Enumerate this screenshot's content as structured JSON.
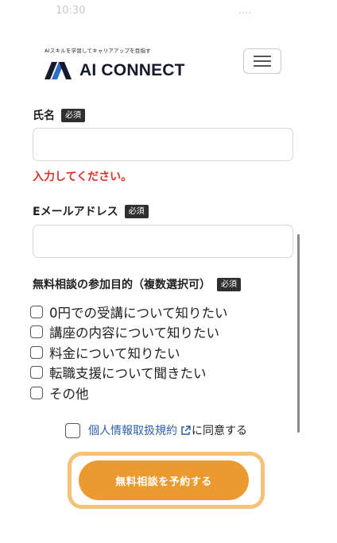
{
  "status_bar": {
    "left_text": "10:30",
    "right_text": "...."
  },
  "header": {
    "tagline": "AIスキルを学習してキャリアアップを目指す",
    "brand": "AI CONNECT",
    "brand_color": "#15192b"
  },
  "form": {
    "name": {
      "label": "氏名",
      "badge": "必須",
      "value": "",
      "error": "入力してください。"
    },
    "email": {
      "label": "Eメールアドレス",
      "badge": "必須",
      "value": ""
    },
    "purpose": {
      "label": "無料相談の参加目的（複数選択可）",
      "badge": "必須",
      "options": [
        {
          "label": "0円での受講について知りたい",
          "checked": false
        },
        {
          "label": "講座の内容について知りたい",
          "checked": false
        },
        {
          "label": "料金について知りたい",
          "checked": false
        },
        {
          "label": "転職支援について聞きたい",
          "checked": false
        },
        {
          "label": "その他",
          "checked": false
        }
      ]
    },
    "agreement": {
      "link_text": "個人情報取扱規約",
      "suffix": "に同意する",
      "checked": false
    },
    "submit_label": "無料相談を予約する"
  },
  "colors": {
    "accent": "#ea9a2e",
    "error": "#d8362a",
    "link": "#2d5ea8"
  }
}
